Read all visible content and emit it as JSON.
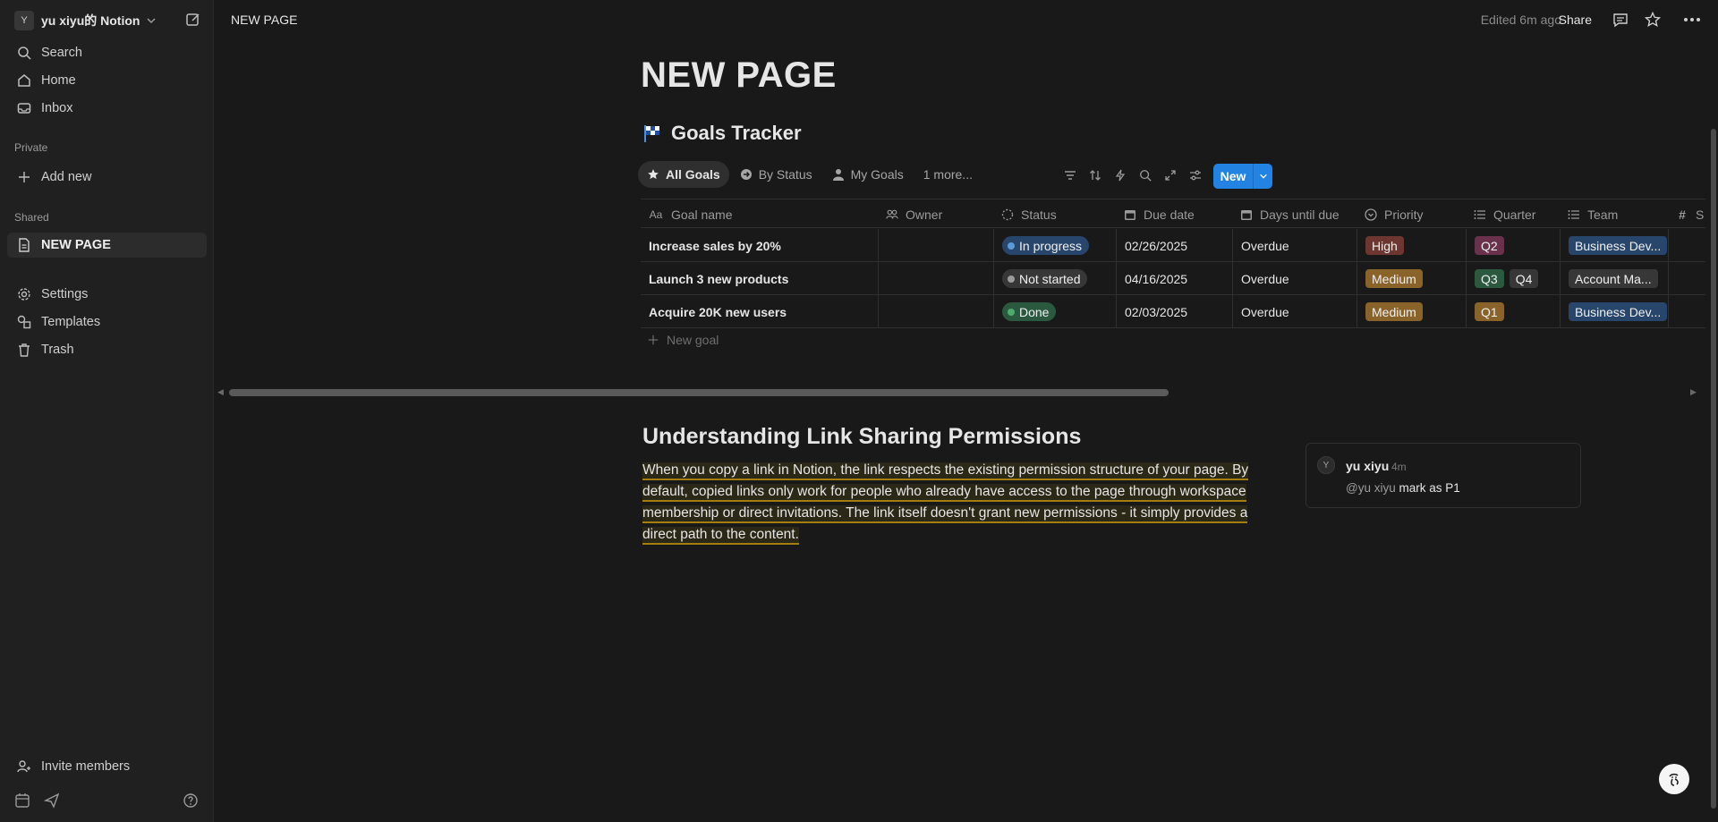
{
  "sidebar": {
    "workspace_initial": "Y",
    "workspace_name": "yu xiyu的 Notion",
    "nav": [
      {
        "label": "Search"
      },
      {
        "label": "Home"
      },
      {
        "label": "Inbox"
      }
    ],
    "private_label": "Private",
    "add_new": "Add new",
    "shared_label": "Shared",
    "shared_page": "NEW PAGE",
    "tools": [
      {
        "label": "Settings"
      },
      {
        "label": "Templates"
      },
      {
        "label": "Trash"
      }
    ],
    "invite": "Invite members"
  },
  "topbar": {
    "breadcrumb": "NEW PAGE",
    "edited": "Edited 6m ago",
    "share": "Share"
  },
  "page": {
    "title": "NEW PAGE",
    "database": {
      "title": "Goals Tracker",
      "views": [
        "All Goals",
        "By Status",
        "My Goals",
        "1 more..."
      ],
      "new_button": "New",
      "columns": [
        "Goal name",
        "Owner",
        "Status",
        "Due date",
        "Days until due",
        "Priority",
        "Quarter",
        "Team",
        "S"
      ],
      "rows": [
        {
          "name": "Increase sales by 20%",
          "owner": "",
          "status": "In progress",
          "due": "02/26/2025",
          "days": "Overdue",
          "priority": "High",
          "quarters": [
            "Q2"
          ],
          "team": "Business Dev..."
        },
        {
          "name": "Launch 3 new products",
          "owner": "",
          "status": "Not started",
          "due": "04/16/2025",
          "days": "Overdue",
          "priority": "Medium",
          "quarters": [
            "Q3",
            "Q4"
          ],
          "team": "Account Ma..."
        },
        {
          "name": "Acquire 20K new users",
          "owner": "",
          "status": "Done",
          "due": "02/03/2025",
          "days": "Overdue",
          "priority": "Medium",
          "quarters": [
            "Q1"
          ],
          "team": "Business Dev..."
        }
      ],
      "new_goal": "New goal"
    },
    "heading": "Understanding Link Sharing Permissions",
    "paragraph": "When you copy a link in Notion, the link respects the existing permission structure of your page. By default, copied links only work for people who already have access to the page through workspace membership or direct invitations. The link itself doesn't grant new permissions - it simply provides a direct path to the content."
  },
  "comment": {
    "avatar": "Y",
    "author": "yu xiyu",
    "time": "4m",
    "mention": "@yu xiyu",
    "text": "mark as P1"
  },
  "colors": {
    "accent": "#2383e2",
    "status_in_progress": "#28456c",
    "status_not_started": "#373737",
    "status_done": "#2b593f",
    "priority_high": "#6e3630",
    "priority_medium": "#89632a",
    "q1": "#89632a",
    "q2": "#69314c",
    "q3": "#2b593f",
    "q4": "#373737",
    "team_blue": "#28456c",
    "team_gray": "#373737"
  }
}
